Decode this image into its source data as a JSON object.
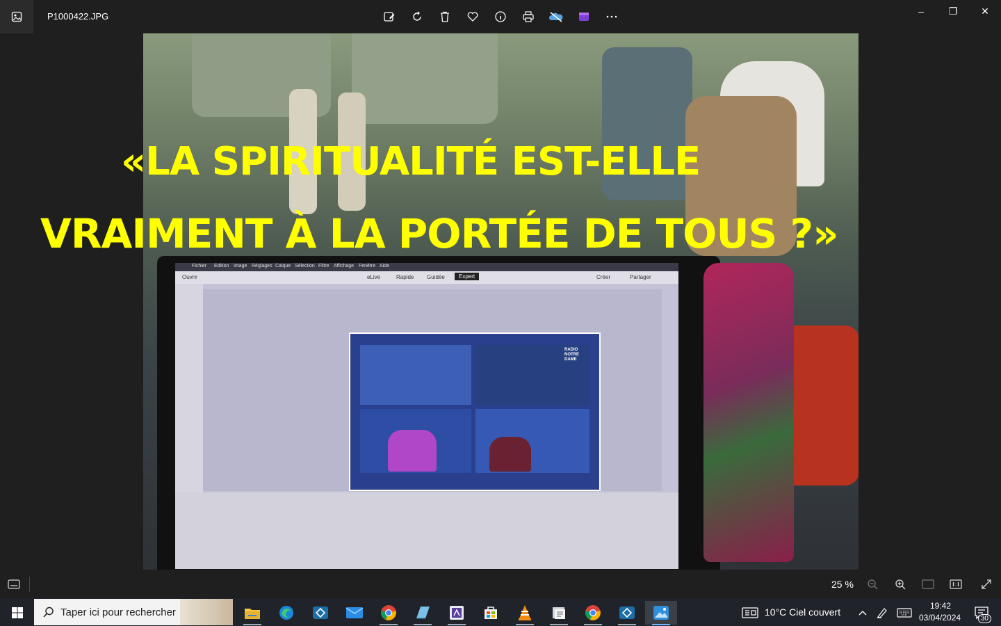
{
  "window": {
    "filename": "P1000422.JPG",
    "toolbar_icons": [
      "edit-image-icon",
      "rotate-icon",
      "delete-icon",
      "favorite-icon",
      "info-icon",
      "print-icon",
      "onedrive-icon",
      "clipchamp-icon",
      "more-icon"
    ],
    "controls": {
      "minimize": "–",
      "maximize": "❐",
      "close": "✕"
    }
  },
  "photo": {
    "headline_line1": "«LA SPIRITUALITÉ EST-ELLE",
    "headline_line2": "VRAIMENT À LA PORTÉE DE TOUS ?»",
    "headline_color": "#ffff00",
    "screen_menu": [
      "Fichier",
      "Edition",
      "Image",
      "Réglages",
      "Calque",
      "Sélection",
      "Filtre",
      "Affichage",
      "Fenêtre",
      "Aide"
    ],
    "screen_tabs": [
      "eLive",
      "Rapide",
      "Guidée",
      "Expert"
    ],
    "screen_open": "Ouvrir",
    "screen_create": "Créer",
    "screen_share": "Partager",
    "screen_logo": "RADIO NOTRE DAME"
  },
  "statusbar": {
    "zoom": "25 %"
  },
  "taskbar": {
    "search_placeholder": "Taper ici pour rechercher",
    "weather": "10°C  Ciel couvert",
    "time": "19:42",
    "date": "03/04/2024",
    "notifications": "30",
    "apps": [
      "file-explorer-icon",
      "edge-icon",
      "app-icon",
      "mail-icon",
      "chrome-icon",
      "notes-icon",
      "app2-icon",
      "store-icon",
      "vlc-icon",
      "files-icon",
      "chrome2-icon",
      "app3-icon",
      "photos-icon"
    ]
  }
}
